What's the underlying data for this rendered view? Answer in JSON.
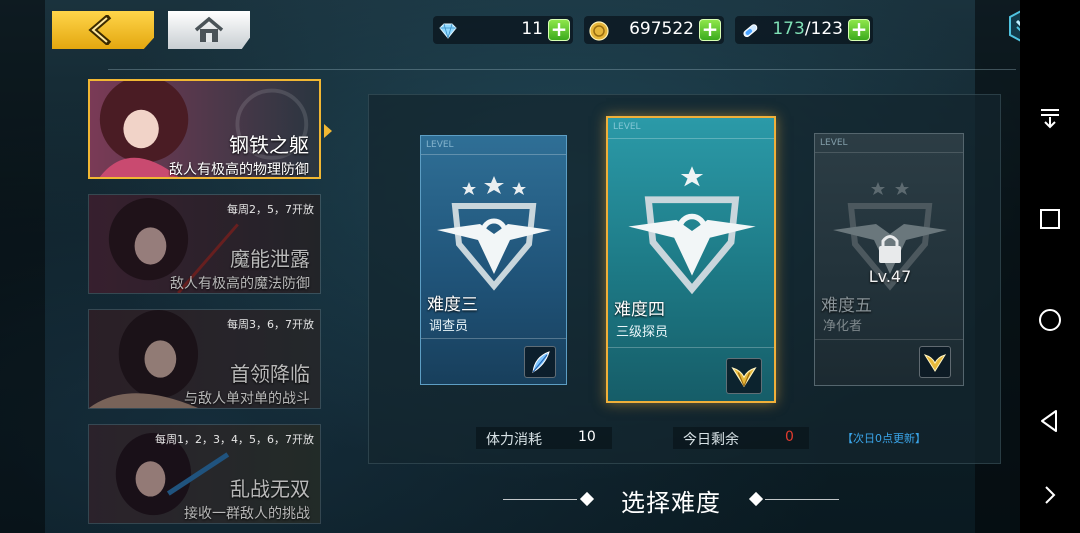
{
  "topbar": {
    "back_icon": "chevron-left-icon",
    "home_icon": "home-icon",
    "gems": {
      "icon": "diamond-icon",
      "value": "11",
      "plus": "+"
    },
    "gold": {
      "icon": "coin-icon",
      "value": "697522",
      "plus": "+"
    },
    "stamina": {
      "icon": "energy-vial-icon",
      "current": "173",
      "separator": "/",
      "max": "123",
      "plus": "+"
    },
    "corner_icon": "chevron-down-badge-icon"
  },
  "modes": [
    {
      "name": "钢铁之躯",
      "desc": "敌人有极高的物理防御",
      "schedule": "",
      "active": true
    },
    {
      "name": "魔能泄露",
      "desc": "敌人有极高的魔法防御",
      "schedule": "每周2，5，7开放",
      "active": false
    },
    {
      "name": "首领降临",
      "desc": "与敌人单对单的战斗",
      "schedule": "每周3，6，7开放",
      "active": false
    },
    {
      "name": "乱战无双",
      "desc": "接收一群敌人的挑战",
      "schedule": "每周1，2，3，4，5，6，7开放",
      "active": false
    }
  ],
  "difficulties": [
    {
      "level_tag": "LEVEL",
      "name": "难度三",
      "subtitle": "调查员",
      "locked": false,
      "lock_text": "",
      "reward_icon": "blue-feather-icon"
    },
    {
      "level_tag": "LEVEL",
      "name": "难度四",
      "subtitle": "三级探员",
      "locked": false,
      "lock_text": "",
      "reward_icon": "gold-wings-icon"
    },
    {
      "level_tag": "LEVEL",
      "name": "难度五",
      "subtitle": "净化者",
      "locked": true,
      "lock_text": "Lv.47",
      "reward_icon": "gold-wings-icon"
    }
  ],
  "stamina_cost": {
    "label": "体力消耗",
    "value": "10"
  },
  "remaining_today": {
    "label": "今日剩余",
    "value": "0"
  },
  "next_update": "【次日0点更新】",
  "page_title": "选择难度",
  "colors": {
    "accent_gold": "#f1b733",
    "selected_teal": "#1f7c8a",
    "plus_green": "#5cc92f",
    "info_blue": "#3aa4e8",
    "remaining_red": "#e23b2e"
  },
  "navbar": {
    "icons": [
      "collapse-down-icon",
      "square-icon",
      "circle-icon",
      "triangle-back-icon",
      "chevron-right-icon"
    ]
  }
}
